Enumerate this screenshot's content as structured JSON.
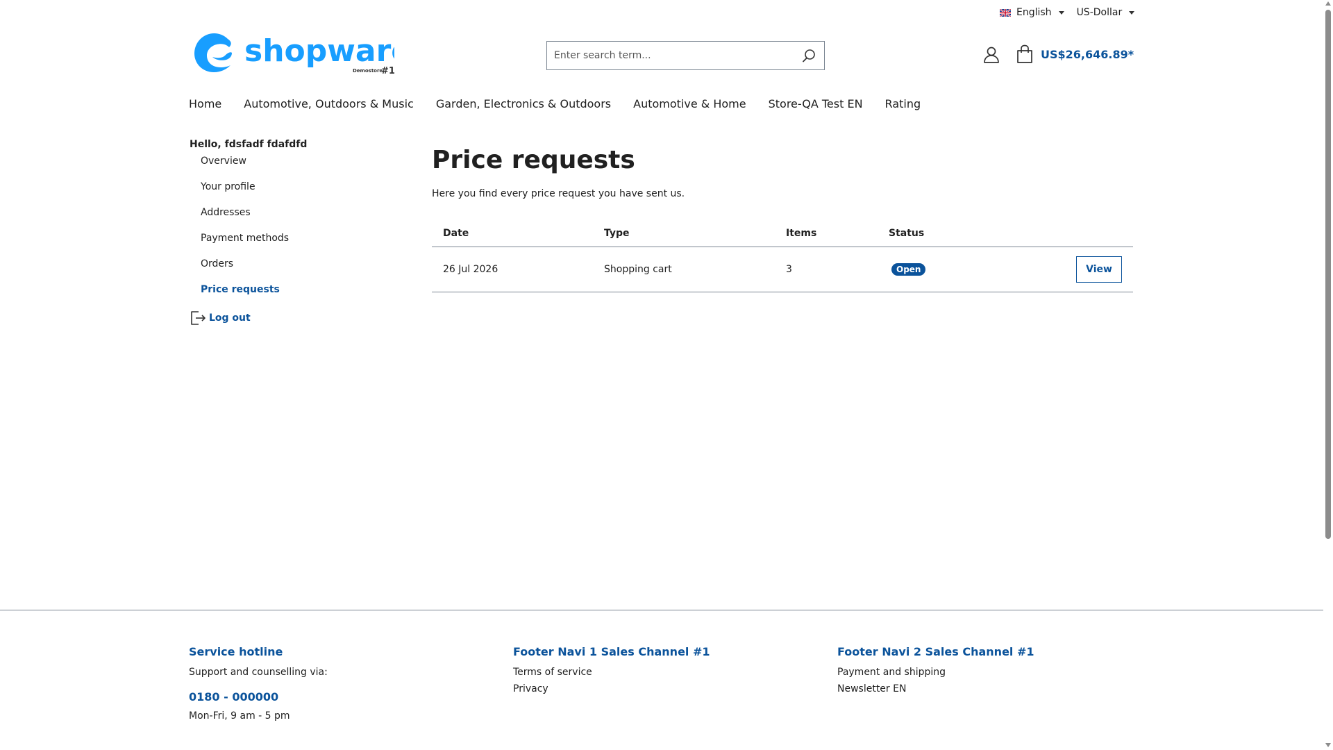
{
  "topbar": {
    "language": {
      "label": "English",
      "icon": "uk-flag-icon"
    },
    "currency": {
      "label": "US-Dollar"
    }
  },
  "header": {
    "logo": {
      "brand": "shopware",
      "sub": "Demostore",
      "badge": "#1"
    },
    "search": {
      "placeholder": "Enter search term...",
      "icon": "search-icon"
    },
    "account_icon": "user-icon",
    "cart": {
      "icon": "shopping-bag-icon",
      "total": "US$26,646.89*"
    }
  },
  "mainnav": {
    "items": [
      {
        "label": "Home"
      },
      {
        "label": "Automotive, Outdoors & Music"
      },
      {
        "label": "Garden, Electronics & Outdoors"
      },
      {
        "label": "Automotive & Home"
      },
      {
        "label": "Store-QA Test EN"
      },
      {
        "label": "Rating"
      }
    ]
  },
  "sidebar": {
    "greeting": "Hello, fdsfadf fdafdfd",
    "items": [
      {
        "label": "Overview"
      },
      {
        "label": "Your profile"
      },
      {
        "label": "Addresses"
      },
      {
        "label": "Payment methods"
      },
      {
        "label": "Orders"
      },
      {
        "label": "Price requests",
        "active": true
      }
    ],
    "logout": {
      "label": "Log out",
      "icon": "logout-icon"
    }
  },
  "main": {
    "title": "Price requests",
    "intro": "Here you find every price request you have sent us.",
    "table": {
      "headers": [
        "Date",
        "Type",
        "Items",
        "Status"
      ],
      "rows": [
        {
          "date": "26 Jul 2026",
          "type": "Shopping cart",
          "items": "3",
          "status": "Open",
          "action": "View"
        }
      ]
    }
  },
  "footer": {
    "col1": {
      "title": "Service hotline",
      "text": "Support and counselling via:",
      "hotline": "0180 - 000000",
      "hours": "Mon-Fri, 9 am - 5 pm"
    },
    "col2": {
      "title": "Footer Navi 1 Sales Channel #1",
      "links": [
        "Terms of service",
        "Privacy"
      ]
    },
    "col3": {
      "title": "Footer Navi 2 Sales Channel #1",
      "links": [
        "Payment and shipping",
        "Newsletter EN"
      ]
    }
  },
  "colors": {
    "brand_blue": "#189eff",
    "link_blue": "#0b539b",
    "text": "#202020",
    "border": "#798490"
  }
}
